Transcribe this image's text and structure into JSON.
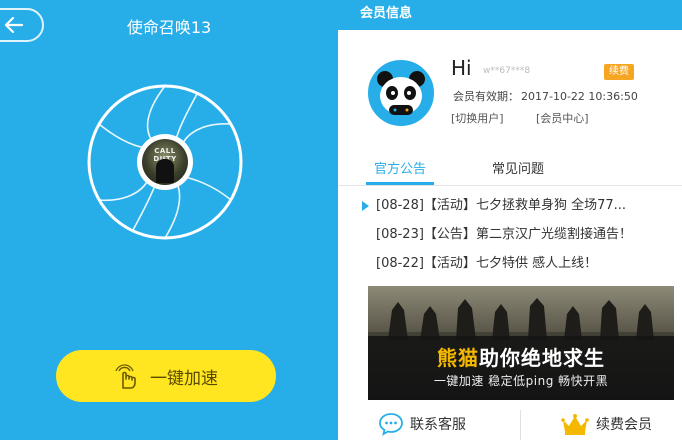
{
  "left": {
    "game_title": "使命召唤13",
    "game_cover_text": "CALL DUTY",
    "accelerate_label": "一键加速"
  },
  "member": {
    "header": "会员信息",
    "greeting": "Hi",
    "username": "w**67***8 ",
    "badge": "续费",
    "expiry_label": "会员有效期：",
    "expiry_value": "2017-10-22 10:36:50",
    "switch_user": "[切换用户]",
    "member_center": "[会员中心]"
  },
  "tabs": [
    {
      "label": "官方公告",
      "active": true
    },
    {
      "label": "常见问题",
      "active": false
    }
  ],
  "news": [
    {
      "date": "[08-28]",
      "tag": "【活动】",
      "text": "七夕拯救单身狗 全场77..."
    },
    {
      "date": "[08-23]",
      "tag": "【公告】",
      "text": "第二京汉广光缆割接通告！"
    },
    {
      "date": "[08-22]",
      "tag": "【活动】",
      "text": "七夕特供 感人上线！"
    }
  ],
  "banner": {
    "title_highlight": "熊猫",
    "title_rest": "助你绝地求生",
    "subtitle": "一键加速 稳定低ping 畅快开黑"
  },
  "footer": {
    "service_label": "联系客服",
    "renew_label": "续费会员"
  },
  "colors": {
    "brand_blue": "#27aee9",
    "accel_yellow": "#ffe620",
    "badge_orange": "#f5a623",
    "crown_gold": "#f5b800"
  },
  "icons": {
    "back": "arrow-left-icon",
    "accelerate": "hand-pointer-icon",
    "service": "chat-bubble-icon",
    "renew": "crown-icon"
  }
}
